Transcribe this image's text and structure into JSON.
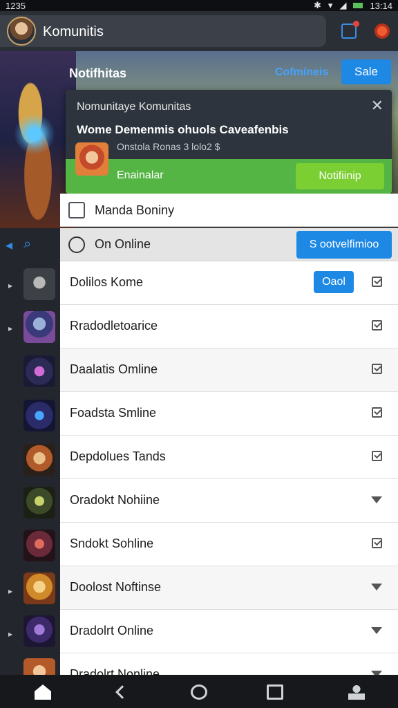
{
  "status_bar": {
    "time": "1235",
    "clock_right": "13:14"
  },
  "app_bar": {
    "title": "Komunitis"
  },
  "banner": {
    "title": "Notifhitas",
    "link": "Cofmineis",
    "button": "Sale"
  },
  "notification": {
    "header": "Nomunitaye Komunitas",
    "message": "Wome Demenmis ohuols Caveafenbis",
    "sub": "Onstola Ronas 3 lolo2 $",
    "action_text": "Enainalar",
    "action_button": "Notifiinip"
  },
  "section": {
    "title": "Manda Boniny"
  },
  "list_top": {
    "label": "On Online",
    "button": "S ootvelfimioo"
  },
  "rows": [
    {
      "label": "Dolilos Kome",
      "button": "Oaol",
      "indicator": "check"
    },
    {
      "label": "Rradodletoarice",
      "indicator": "check"
    },
    {
      "label": "Daalatis Omline",
      "indicator": "check"
    },
    {
      "label": "Foadsta Smline",
      "indicator": "check"
    },
    {
      "label": "Depdolues Tands",
      "indicator": "check"
    },
    {
      "label": "Oradokt Nohiine",
      "indicator": "triangle"
    },
    {
      "label": "Sndokt Sohline",
      "indicator": "check"
    },
    {
      "label": "Doolost Noftinse",
      "indicator": "triangle"
    },
    {
      "label": "Dradolrt Online",
      "indicator": "triangle"
    },
    {
      "label": "Dradolrt Nonline",
      "indicator": "triangle"
    }
  ],
  "colors": {
    "accent_blue": "#1e88e5",
    "accent_green": "#54b544",
    "app_bar": "#2a2e35"
  },
  "icons": [
    "avatar",
    "share-icon",
    "gift-icon",
    "back-arrow-icon",
    "search-icon",
    "home-icon",
    "back-icon",
    "chat-icon",
    "square-icon",
    "person-icon"
  ]
}
